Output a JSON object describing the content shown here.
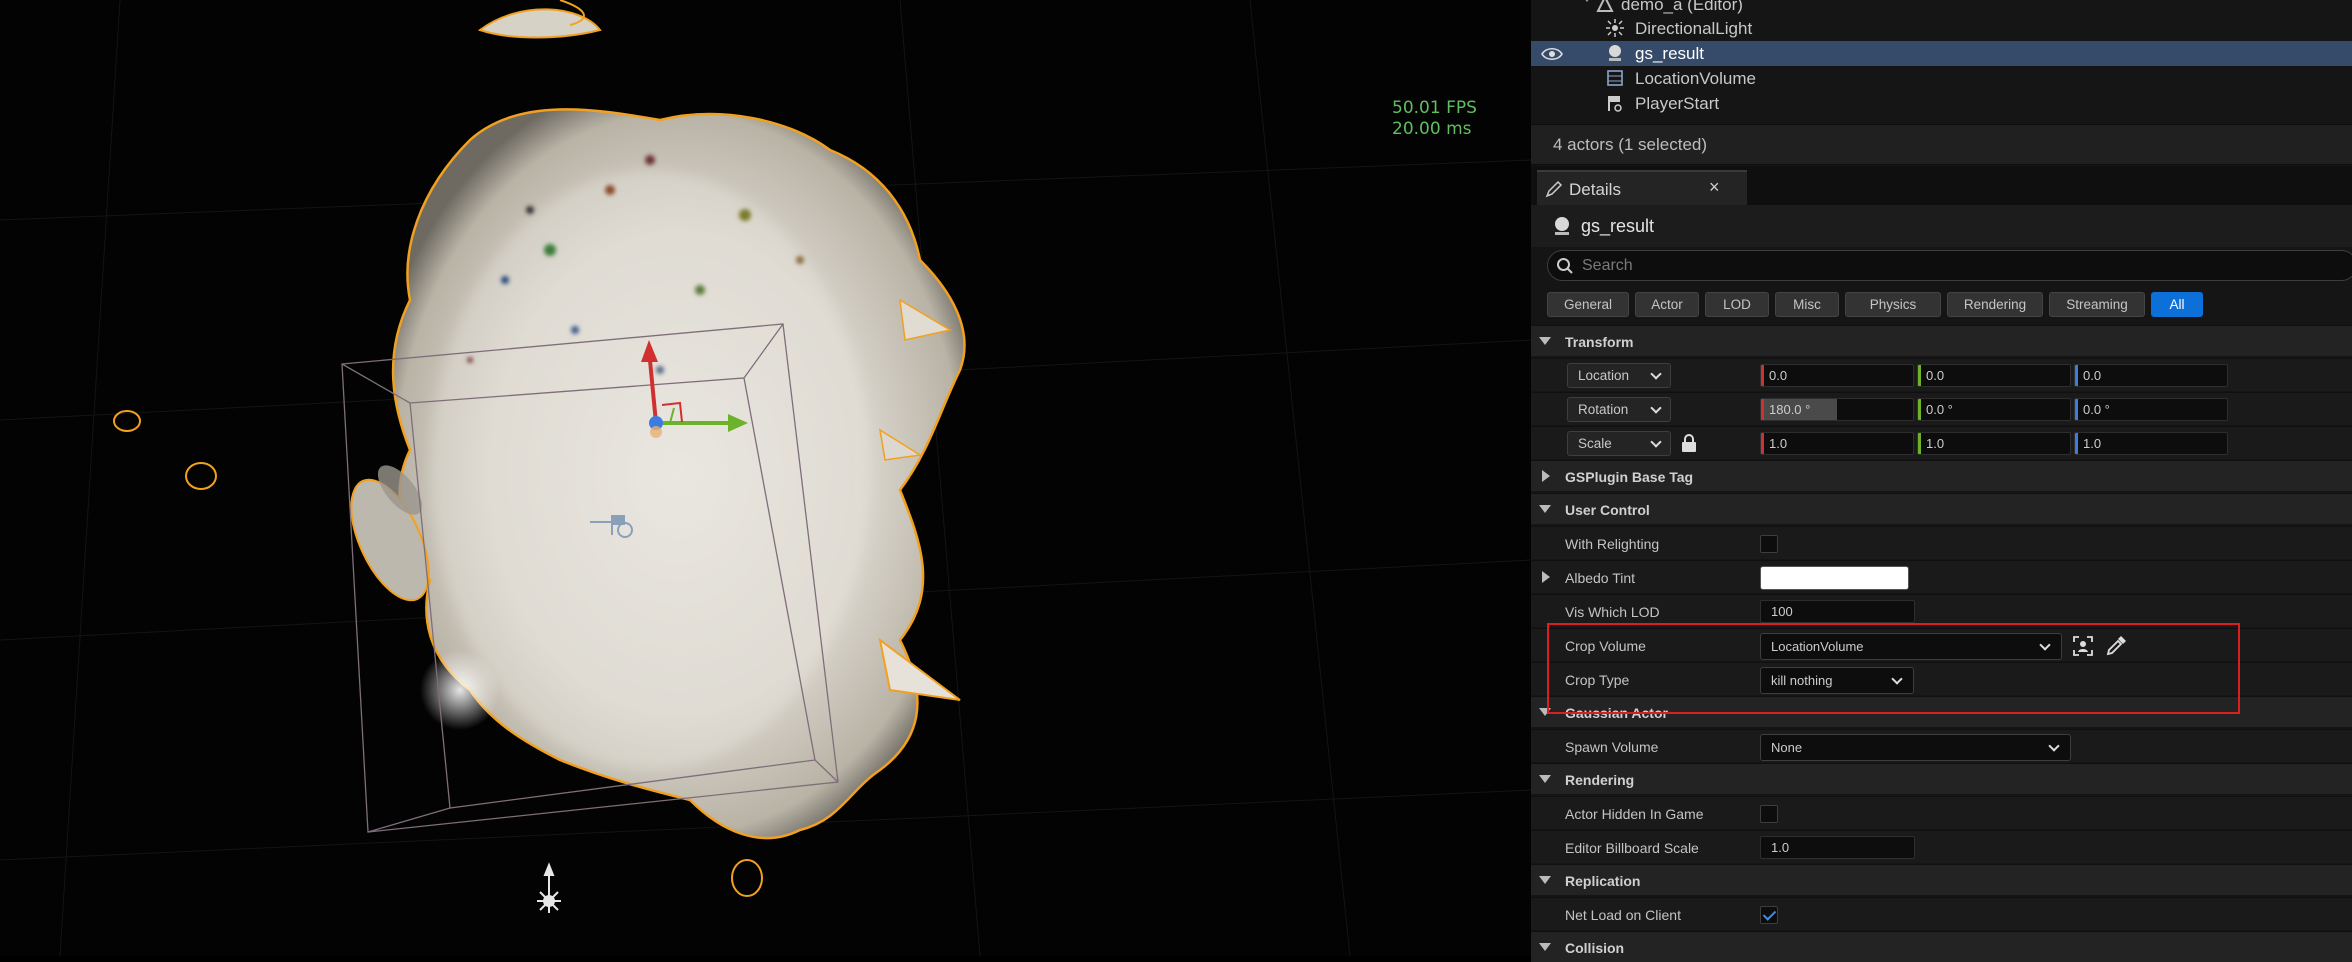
{
  "viewport": {
    "fps": "50.01 FPS",
    "ms": "20.00 ms"
  },
  "outliner": {
    "items": [
      {
        "label": "demo_a (Editor)",
        "icon": "level-icon"
      },
      {
        "label": "DirectionalLight",
        "icon": "directional-light-icon"
      },
      {
        "label": "gs_result",
        "icon": "actor-sphere-icon",
        "selected": true
      },
      {
        "label": "LocationVolume",
        "icon": "volume-icon"
      },
      {
        "label": "PlayerStart",
        "icon": "player-start-icon"
      }
    ],
    "status": "4 actors (1 selected)"
  },
  "details": {
    "tab_label": "Details",
    "close_glyph": "×",
    "actor_name": "gs_result",
    "search_placeholder": "Search",
    "filters": [
      "General",
      "Actor",
      "LOD",
      "Misc",
      "Physics",
      "Rendering",
      "Streaming",
      "All"
    ],
    "active_filter": "All",
    "transform": {
      "header": "Transform",
      "location": {
        "label": "Location",
        "x": "0.0",
        "y": "0.0",
        "z": "0.0"
      },
      "rotation": {
        "label": "Rotation",
        "x": "180.0 °",
        "y": "0.0 °",
        "z": "0.0 °"
      },
      "scale": {
        "label": "Scale",
        "x": "1.0",
        "y": "1.0",
        "z": "1.0"
      }
    },
    "gsplugin_header": "GSPlugin Base Tag",
    "user_control": {
      "header": "User Control",
      "with_relighting": {
        "label": "With Relighting",
        "checked": false
      },
      "albedo_tint": {
        "label": "Albedo Tint",
        "color": "#ffffff"
      },
      "vis_which_lod": {
        "label": "Vis Which LOD",
        "value": "100"
      },
      "crop_volume": {
        "label": "Crop Volume",
        "value": "LocationVolume"
      },
      "crop_type": {
        "label": "Crop Type",
        "value": "kill nothing"
      }
    },
    "gaussian_actor": {
      "header": "Gaussian Actor",
      "spawn_volume": {
        "label": "Spawn Volume",
        "value": "None"
      }
    },
    "rendering": {
      "header": "Rendering",
      "actor_hidden": {
        "label": "Actor Hidden In Game",
        "checked": false
      },
      "billboard_scale": {
        "label": "Editor Billboard Scale",
        "value": "1.0"
      }
    },
    "replication": {
      "header": "Replication",
      "net_load": {
        "label": "Net Load on Client",
        "checked": true
      }
    },
    "collision_header": "Collision"
  },
  "colors": {
    "x_axis": "#d03030",
    "y_axis": "#6cb22a",
    "z_axis": "#3d7be0",
    "selection_outline": "#f2a020",
    "active_filter": "#0d6fd8",
    "highlight_box": "#d91f1f"
  }
}
